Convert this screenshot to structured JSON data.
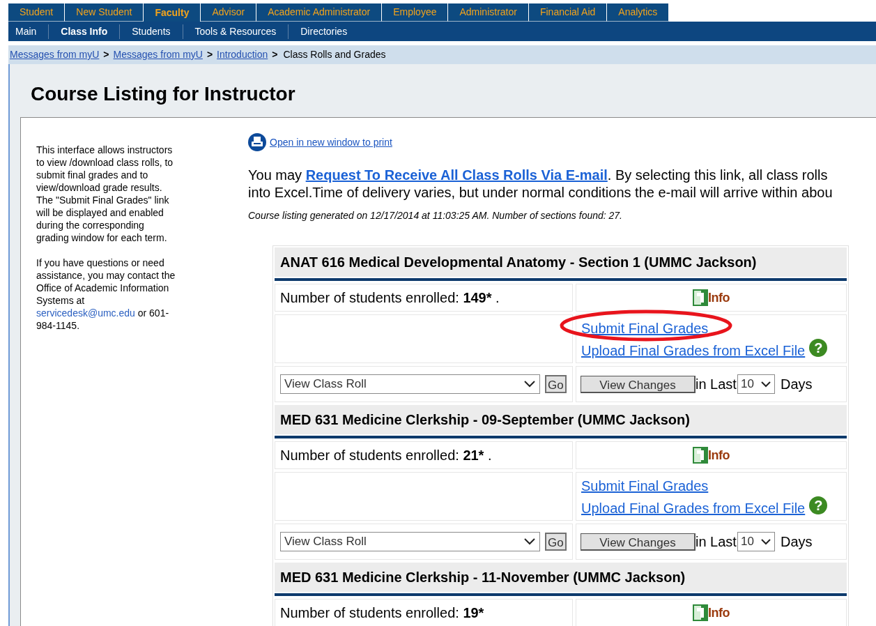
{
  "top_tabs": [
    {
      "label": "Student",
      "selected": false
    },
    {
      "label": "New Student",
      "selected": false
    },
    {
      "label": "Faculty",
      "selected": true
    },
    {
      "label": "Advisor",
      "selected": false
    },
    {
      "label": "Academic Administrator",
      "selected": false
    },
    {
      "label": "Employee",
      "selected": false
    },
    {
      "label": "Administrator",
      "selected": false
    },
    {
      "label": "Financial Aid",
      "selected": false
    },
    {
      "label": "Analytics",
      "selected": false
    }
  ],
  "sub_nav": [
    {
      "label": "Main",
      "selected": false
    },
    {
      "label": "Class Info",
      "selected": true
    },
    {
      "label": "Students",
      "selected": false
    },
    {
      "label": "Tools & Resources",
      "selected": false
    },
    {
      "label": "Directories",
      "selected": false
    }
  ],
  "breadcrumb": [
    {
      "kind": "link",
      "text": "Messages from myU"
    },
    {
      "kind": "separator",
      "text": ">"
    },
    {
      "kind": "link",
      "text": "Messages from myU"
    },
    {
      "kind": "separator",
      "text": ">"
    },
    {
      "kind": "link",
      "text": "Introduction"
    },
    {
      "kind": "separator",
      "text": ">"
    },
    {
      "kind": "current",
      "text": "Class Rolls and Grades"
    }
  ],
  "heading": "Course Listing for Instructor",
  "sidebar": {
    "intro": "This interface allows instructors to view /download class rolls, to submit final grades and to view/download grade results. The \"Submit Final Grades\" link will be displayed and enabled during the corresponding grading window for each term.",
    "contact_before": "If you have questions or need assistance, you may contact the Office of Academic Information Systems at",
    "contact_email": "servicedesk@umc.edu",
    "contact_after": "or 601-984-1145."
  },
  "print_link": "Open in new window to print",
  "notice": {
    "before": "You may",
    "link": "Request To Receive All Class Rolls Via E-mail",
    "after": ". By selecting this link, all class rolls",
    "line2": "into Excel.Time of delivery varies, but under normal conditions the e-mail will arrive within abou"
  },
  "generated_note": "Course listing generated on 12/17/2014 at 11:03:25 AM. Number of sections found: 27.",
  "sections": [
    {
      "title": "ANAT 616 Medical Developmental Anatomy - Section 1 (UMMC Jackson)",
      "enrolled_label": "Number of students enrolled:",
      "enrolled_count": "149*",
      "enrolled_suffix": ".",
      "info_label": "Info",
      "submit_link": "Submit Final Grades",
      "upload_link": "Upload Final Grades from Excel File",
      "help_icon": "?",
      "roll_select": "View Class Roll",
      "go_button": "Go",
      "view_changes_button": "View Changes",
      "in_last_label": "in Last",
      "days_select": "10",
      "days_label": "Days",
      "highlighted": true
    },
    {
      "title": "MED 631 Medicine Clerkship - 09-September (UMMC Jackson)",
      "enrolled_label": "Number of students enrolled:",
      "enrolled_count": "21*",
      "enrolled_suffix": ".",
      "info_label": "Info",
      "submit_link": "Submit Final Grades",
      "upload_link": "Upload Final Grades from Excel File",
      "help_icon": "?",
      "roll_select": "View Class Roll",
      "go_button": "Go",
      "view_changes_button": "View Changes",
      "in_last_label": "in Last",
      "days_select": "10",
      "days_label": "Days",
      "highlighted": false
    },
    {
      "title": "MED 631 Medicine Clerkship - 11-November (UMMC Jackson)",
      "enrolled_label": "Number of students enrolled:",
      "enrolled_count": "19*",
      "info_label": "Info",
      "highlighted": false
    }
  ]
}
